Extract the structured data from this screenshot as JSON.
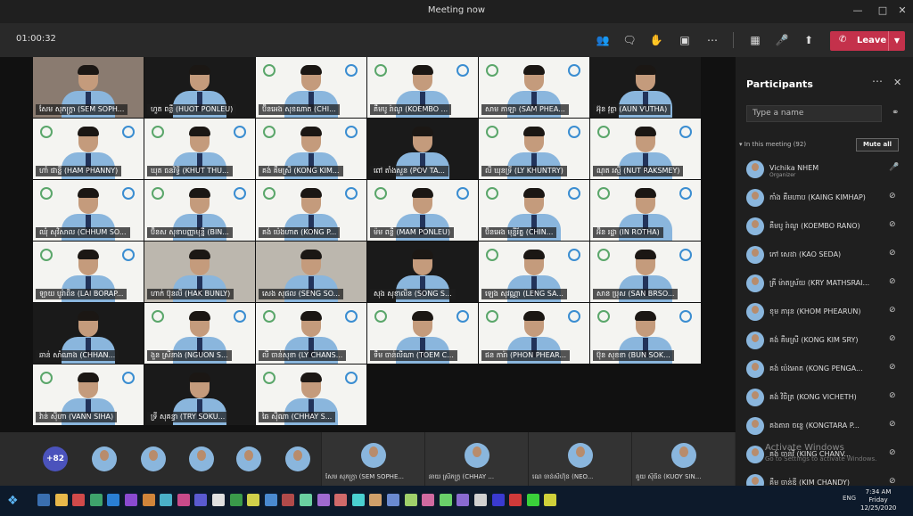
{
  "window": {
    "title": "Meeting now"
  },
  "toolbar": {
    "timer": "01:00:32",
    "leave_label": "Leave"
  },
  "tiles": [
    {
      "name": "សែម សុភក្ត្រា (SEM SOPH...",
      "style": "room"
    },
    {
      "name": "ហួត ពន្លឺ (HUOT PONLEU)",
      "style": "dark"
    },
    {
      "name": "ប៊ិនអេង សុខណាត (CHI...",
      "style": "logo"
    },
    {
      "name": "គឹមបូ រ៉ាណូ (KOEMBO ...",
      "style": "logo"
    },
    {
      "name": "សាម ភាឡា (SAM PHEA...",
      "style": "logo"
    },
    {
      "name": "អ៊ុន វុត្ថា (AUN VUTHA)",
      "style": "dark"
    },
    {
      "name": "ហាំ ផាន្នី (HAM PHANNY)",
      "style": "logo"
    },
    {
      "name": "ឃុត ធនវិទ្ធី (KHUT THU...",
      "style": "logo"
    },
    {
      "name": "គង់ គឹមស្រី (KONG KIM...",
      "style": "logo"
    },
    {
      "name": "ពៅ តាំងសួន (POV TA...",
      "style": "dark"
    },
    {
      "name": "លី ឃុនទ្រី (LY KHUNTRY)",
      "style": "logo"
    },
    {
      "name": "ណុត រស្មី (NUT RAKSMEY)",
      "style": "logo"
    },
    {
      "name": "ឈុំ សុវិសាល (CHHUM SO...",
      "style": "logo"
    },
    {
      "name": "ប៊ិនស សុខាបញ្ញាមុន្នី (BIN...",
      "style": "logo"
    },
    {
      "name": "គង់ ប៉េងហាត (KONG P...",
      "style": "logo"
    },
    {
      "name": "ម៉ម ពន្លឺ (MAM PONLEU)",
      "style": "logo"
    },
    {
      "name": "ប៊ិនអេង មុន្នីរ័ត្ន (CHIN...",
      "style": "logo"
    },
    {
      "name": "អ៊ិន រដ្ឋា (IN ROTHA)",
      "style": "logo"
    },
    {
      "name": "ឡាយ បូរ៉ាពីន (LAI BORAP...",
      "style": "logo"
    },
    {
      "name": "ហាក់ ប៊ុនលី (HAK BUNLY)",
      "style": "room2"
    },
    {
      "name": "សេង សុផល (SENG SO...",
      "style": "room2"
    },
    {
      "name": "សុង សុខាលីន (SONG S...",
      "style": "dark"
    },
    {
      "name": "ឡេង សុវណ្ណា (LENG SA...",
      "style": "logo"
    },
    {
      "name": "សាន ប្រុស (SAN BRSO...",
      "style": "logo"
    },
    {
      "name": "ឆាន់ សាំណាង (CHHAN...",
      "style": "dark"
    },
    {
      "name": "ងួន ស្រីនាង (NGUON S...",
      "style": "logo"
    },
    {
      "name": "លី ចាន់សុខា (LY CHANS...",
      "style": "logo"
    },
    {
      "name": "ទឹម ចាន់លីណា (TOEM C...",
      "style": "logo"
    },
    {
      "name": "ផន ភារ៉ា (PHON PHEAR...",
      "style": "logo"
    },
    {
      "name": "ប៊ុន សុខខា (BUN SOK...",
      "style": "logo"
    },
    {
      "name": "វ៉ាន់ ស៊ីហា (VANN SIHA)",
      "style": "logo"
    },
    {
      "name": "ទ្រី សុគន្ធា (TRY SOKU...",
      "style": "dark"
    },
    {
      "name": "ឆៃ ស៊ីណា (CHHAY S...",
      "style": "logo"
    }
  ],
  "panel": {
    "title": "Participants",
    "search_placeholder": "Type a name",
    "section_label": "In this meeting (92)",
    "mute_all_label": "Mute all",
    "participants": [
      {
        "name": "Vichika NHEM",
        "role": "Organizer"
      },
      {
        "name": "កាំង គឹមហាប (KAING KIMHAP)",
        "role": ""
      },
      {
        "name": "គឹមបូ រ៉ាណូ (KOEMBO RANO)",
        "role": ""
      },
      {
        "name": "កៅ សេដា (KAO SEDA)",
        "role": ""
      },
      {
        "name": "គ្រី ម៉ាតស្រ័យ (KRY MATHSRAI...",
        "role": ""
      },
      {
        "name": "ខុម ភារុន (KHOM PHEARUN)",
        "role": ""
      },
      {
        "name": "គង់ គឹមស្រី (KONG KIM SRY)",
        "role": ""
      },
      {
        "name": "គង់ ប៉េងអាត (KONG PENGA...",
        "role": ""
      },
      {
        "name": "គង់ វិចិត្រ (KONG VICHETH)",
        "role": ""
      },
      {
        "name": "គងតារា ចន្ទេ (KONGTARA P...",
        "role": ""
      },
      {
        "name": "គង់ ចាន់វី (KING CHANV...",
        "role": ""
      },
      {
        "name": "គឹម ចាន់ឌី (KIM CHANDY)",
        "role": ""
      }
    ]
  },
  "strip": {
    "overflow_label": "+82",
    "tiles": [
      {
        "name": "សែម សុភក្ត្រា (SEM SOPHE..."
      },
      {
        "name": "ឆាយ ស្រីភក្ត្រ (CHHAY ..."
      },
      {
        "name": "ណេ ចាន់សីហ៊ុន (NEO..."
      },
      {
        "name": "គួយ ស៊ីធីន (KUOY SIN..."
      }
    ]
  },
  "watermark": {
    "line1": "Activate Windows",
    "line2": "Go to Settings to activate Windows."
  },
  "taskbar": {
    "lang": "ENG",
    "time": "7:34 AM",
    "day": "Friday",
    "date": "12/25/2020"
  }
}
